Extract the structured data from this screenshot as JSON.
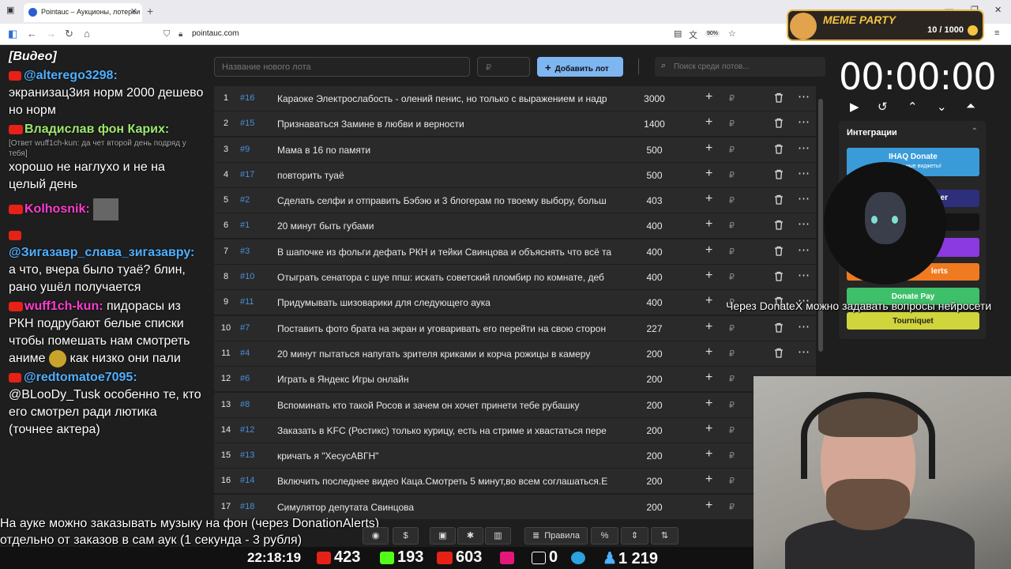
{
  "browser": {
    "tab_title": "Pointauc – Аукционы, лотереи",
    "url": "pointauc.com",
    "zoom": "90%"
  },
  "meme_party": {
    "title": "MEME PARTY",
    "count": "10 / 1000"
  },
  "chat": {
    "header": "[Видео]",
    "messages": [
      {
        "user": "@alterego3298:",
        "text": "экранизац3ия норм 2000 дешево но норм"
      },
      {
        "user": "Владислав фон Карих:",
        "reply": "[Ответ wuff1ch-kun: да чет второй день подряд у тебя]",
        "text": "хорошо не наглухо и не на целый день"
      },
      {
        "user": "Kolhosnik:",
        "text": ""
      },
      {
        "user": "@Зигазавр_слава_зигазавру:",
        "text": "а что, вчера было туаё? блин, рано ушёл получается"
      },
      {
        "user": "wuff1ch-kun:",
        "text": "пидорасы из РКН подрубают белые списки чтобы помешать нам смотреть аниме",
        "text2": "как низко они пали"
      },
      {
        "user": "@redtomatoe7095:",
        "text": "@BLooDy_Tusk особенно те, кто его смотрел ради лютика (точнее актера)"
      }
    ]
  },
  "form": {
    "name_placeholder": "Название нового лота",
    "price_placeholder": "₽",
    "add_label": "Добавить лот",
    "search_placeholder": "Поиск среди лотов..."
  },
  "lots": [
    {
      "n": "1",
      "id": "#16",
      "title": "Караоке Электрослабость - олений пенис, но только с выражением и надр",
      "value": "3000"
    },
    {
      "n": "2",
      "id": "#15",
      "title": "Признаваться Замине в любви и верности",
      "value": "1400"
    },
    {
      "n": "3",
      "id": "#9",
      "title": "Мама в 16 по памяти",
      "value": "500"
    },
    {
      "n": "4",
      "id": "#17",
      "title": "повторить туаё",
      "value": "500"
    },
    {
      "n": "5",
      "id": "#2",
      "title": "Сделать селфи и отправить Бэбэю и 3 блогерам по твоему выбору, больш",
      "value": "403"
    },
    {
      "n": "6",
      "id": "#1",
      "title": "20 минут быть губами",
      "value": "400"
    },
    {
      "n": "7",
      "id": "#3",
      "title": "В шапочке из фольги дефать РКН и тейки Свинцова и объяснять что всё та",
      "value": "400"
    },
    {
      "n": "8",
      "id": "#10",
      "title": "Отыграть сенатора с шуе ппш: искать советский пломбир по комнате, деб",
      "value": "400"
    },
    {
      "n": "9",
      "id": "#11",
      "title": "Придумывать шизоварики для следующего аука",
      "value": "400"
    },
    {
      "n": "10",
      "id": "#7",
      "title": "Поставить фото брата на экран и уговаривать его перейти на свою сторон",
      "value": "227"
    },
    {
      "n": "11",
      "id": "#4",
      "title": "20 минут пытаться напугать зрителя криками и корча рожицы в камеру",
      "value": "200"
    },
    {
      "n": "12",
      "id": "#6",
      "title": "Играть в Яндекс Игры онлайн",
      "value": "200"
    },
    {
      "n": "13",
      "id": "#8",
      "title": "Вспоминать кто такой Росов и зачем он хочет принети тебе рубашку",
      "value": "200"
    },
    {
      "n": "14",
      "id": "#12",
      "title": "Заказать в KFC (Ростикс) только курицу, есть на стриме и хвастаться пере",
      "value": "200"
    },
    {
      "n": "15",
      "id": "#13",
      "title": "кричать я \"ХесусАВГН\"",
      "value": "200"
    },
    {
      "n": "16",
      "id": "#14",
      "title": "Включить последнее видео Каца.Смотреть 5 минут,во всем соглашаться.Е",
      "value": "200"
    },
    {
      "n": "17",
      "id": "#18",
      "title": "Симулятор депутата Свинцова",
      "value": "200"
    }
  ],
  "timer": {
    "display": "00:00:00"
  },
  "integrations": {
    "title": "Интеграции",
    "donate_title": "IHAQ Donate",
    "donate_sub": "Уникальные виджеты!",
    "partial_er": "er",
    "partial_alerts": "lerts",
    "donate_pay": "Donate Pay",
    "tourniquet": "Tourniquet"
  },
  "overlay": {
    "donatex": "Через DonateX можно задавать вопросы нейросети",
    "music_line1": "На ауке можно заказывать музыку на фон (через DonationAlerts)",
    "music_line2": "отдельно от заказов в сам аук (1 секунда - 3 рубля)"
  },
  "toolbar": {
    "rules": "Правила",
    "percent": "%"
  },
  "stats": {
    "time": "22:18:19",
    "youtube": "423",
    "kick": "193",
    "vk": "603",
    "rutube": "0",
    "telegram": "1 219"
  },
  "colors": {
    "accent": "#7eb6f2",
    "lot_id": "#4a90d9",
    "youtube": "#e62117",
    "kick": "#53fc18"
  }
}
